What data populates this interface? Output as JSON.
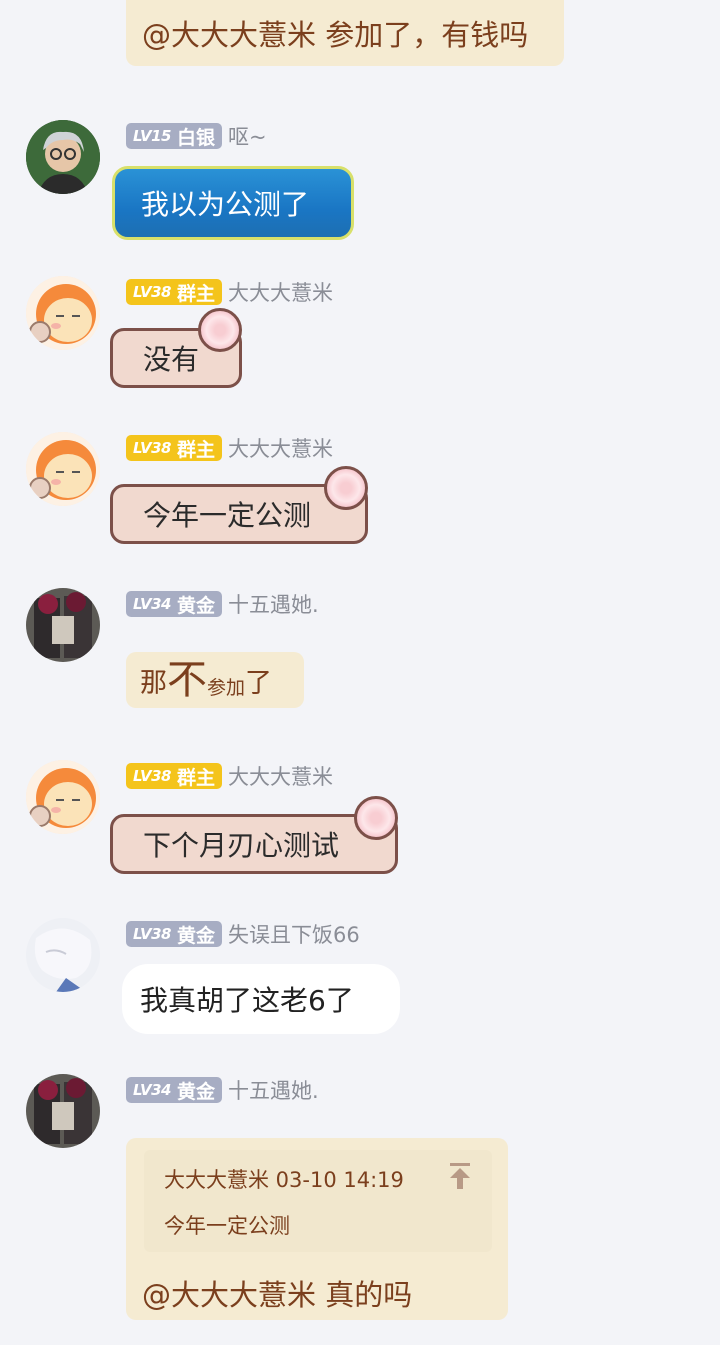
{
  "top_bubble": {
    "text": "@大大大薏米 参加了，有钱吗"
  },
  "messages": [
    {
      "level": "LV15",
      "title": "白银",
      "name": "呕~",
      "text": "我以为公测了"
    },
    {
      "level": "LV38",
      "title": "群主",
      "name": "大大大薏米",
      "text": "没有"
    },
    {
      "level": "LV38",
      "title": "群主",
      "name": "大大大薏米",
      "text": "今年一定公测"
    },
    {
      "level": "LV34",
      "title": "黄金",
      "name": "十五遇她.",
      "text_part1": "那",
      "text_part2": "不",
      "text_part3": "参加",
      "text_part4": "了"
    },
    {
      "level": "LV38",
      "title": "群主",
      "name": "大大大薏米",
      "text": "下个月刃心测试"
    },
    {
      "level": "LV38",
      "title": "黄金",
      "name": "失误且下饭66",
      "text": "我真胡了这老6了"
    },
    {
      "level": "LV34",
      "title": "黄金",
      "name": "十五遇她.",
      "quote_header": "大大大薏米 03-10 14:19",
      "quote_text": "今年一定公测",
      "text": "@大大大薏米 真的吗"
    }
  ],
  "colors": {
    "tan": "#f5ebd2",
    "gold_badge": "#f4c41b",
    "gray_badge": "#a7adc3",
    "background": "#f3f4f8"
  }
}
